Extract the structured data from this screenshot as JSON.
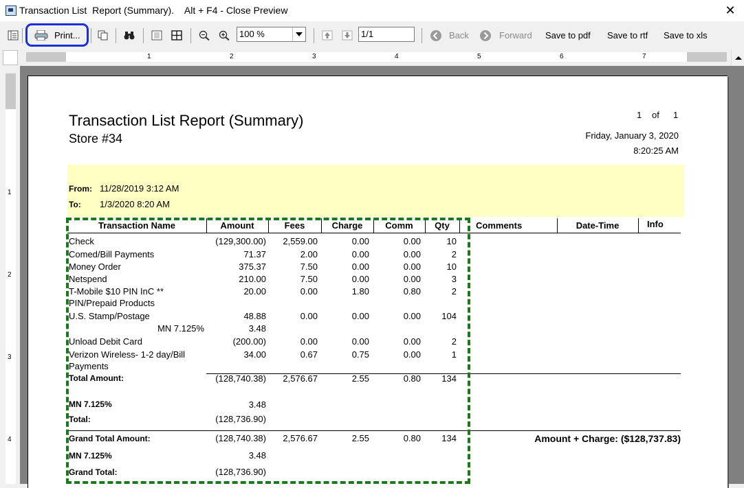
{
  "window": {
    "title": "Transaction List  Report (Summary).    Alt + F4 - Close Preview"
  },
  "toolbar": {
    "print_label": "Print...",
    "zoom_value": "100 %",
    "page_value": "1/1",
    "back_label": "Back",
    "forward_label": "Forward",
    "save_pdf_label": "Save to pdf",
    "save_rtf_label": "Save to rtf",
    "save_xls_label": "Save to xls"
  },
  "ruler": {
    "h_numbers": [
      "1",
      "2",
      "3",
      "4",
      "5",
      "6",
      "7"
    ],
    "v_numbers": [
      "1",
      "2",
      "3",
      "4"
    ]
  },
  "report": {
    "title": "Transaction List  Report (Summary)",
    "store": "Store #34",
    "page_label_num": "1",
    "page_label_of": "of",
    "page_label_total": "1",
    "date": "Friday, January 3, 2020",
    "time": "8:20:25 AM",
    "from_label": "From:",
    "from_value": "11/28/2019 3:12 AM",
    "to_label": "To:",
    "to_value": "1/3/2020 8:20 AM",
    "columns": {
      "name": "Transaction Name",
      "amount": "Amount",
      "fees": "Fees",
      "charge": "Charge",
      "comm": "Comm",
      "qty": "Qty",
      "comments": "Comments",
      "datetime": "Date-Time",
      "info": "Info"
    },
    "rows": [
      {
        "name": "Check",
        "amount": "(129,300.00)",
        "fees": "2,559.00",
        "charge": "0.00",
        "comm": "0.00",
        "qty": "10"
      },
      {
        "name": "Comed/Bill Payments",
        "amount": "71.37",
        "fees": "2.00",
        "charge": "0.00",
        "comm": "0.00",
        "qty": "2"
      },
      {
        "name": "Money Order",
        "amount": "375.37",
        "fees": "7.50",
        "charge": "0.00",
        "comm": "0.00",
        "qty": "10"
      },
      {
        "name": "Netspend",
        "amount": "210.00",
        "fees": "7.50",
        "charge": "0.00",
        "comm": "0.00",
        "qty": "3"
      },
      {
        "name": "T-Mobile $10 PIN InC **",
        "name2": "PIN/Prepaid Products",
        "amount": "20.00",
        "fees": "0.00",
        "charge": "1.80",
        "comm": "0.80",
        "qty": "2"
      },
      {
        "name": "U.S. Stamp/Postage",
        "amount": "48.88",
        "fees": "0.00",
        "charge": "0.00",
        "comm": "0.00",
        "qty": "104"
      },
      {
        "name": "MN 7.125%",
        "amount": "3.48"
      },
      {
        "name": "Unload Debit Card",
        "amount": "(200.00)",
        "fees": "0.00",
        "charge": "0.00",
        "comm": "0.00",
        "qty": "2"
      },
      {
        "name": "Verizon Wireless- 1-2 day/Bill",
        "name2": "Payments",
        "amount": "34.00",
        "fees": "0.67",
        "charge": "0.75",
        "comm": "0.00",
        "qty": "1"
      }
    ],
    "total_amount": {
      "label": "Total Amount:",
      "amount": "(128,740.38)",
      "fees": "2,576.67",
      "charge": "2.55",
      "comm": "0.80",
      "qty": "134"
    },
    "mn_tax": {
      "label": "MN 7.125%",
      "amount": "3.48"
    },
    "total": {
      "label": "Total:",
      "amount": "(128,736.90)"
    },
    "grand_total_amount": {
      "label": "Grand Total Amount:",
      "amount": "(128,740.38)",
      "fees": "2,576.67",
      "charge": "2.55",
      "comm": "0.80",
      "qty": "134"
    },
    "amount_plus_charge": "Amount + Charge:  ($128,737.83)",
    "grand_mn_tax": {
      "label": "MN 7.125%",
      "amount": "3.48"
    },
    "grand_total": {
      "label": "Grand Total:",
      "amount": "(128,736.90)"
    }
  },
  "colors": {
    "highlight_blue": "#1b2fd6",
    "dashed_green": "#1a7a1a",
    "header_yellow": "#ffffc4"
  }
}
